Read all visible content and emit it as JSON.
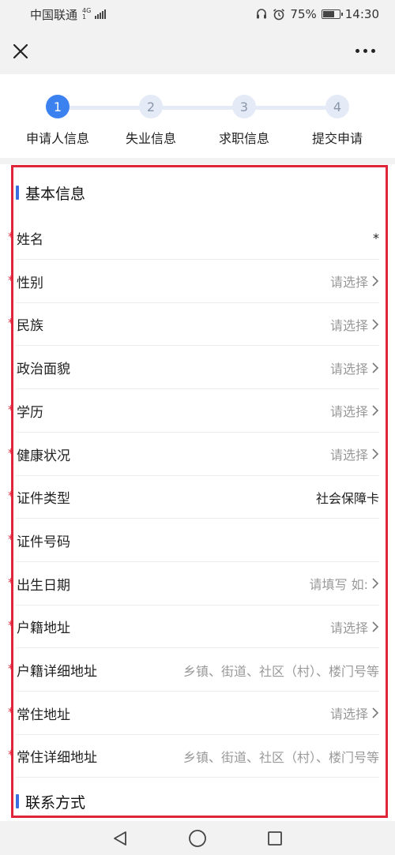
{
  "status": {
    "carrier": "中国联通",
    "net_top": "4G",
    "net_bottom": "1",
    "battery": "75%",
    "battery_level": 0.75,
    "time": "14:30"
  },
  "icons": {
    "close": "close-icon",
    "more": "more-icon",
    "chevron": "chevron-right-icon",
    "back": "back-triangle-icon",
    "home": "home-circle-icon",
    "recent": "recent-square-icon"
  },
  "colors": {
    "accent": "#3b82f0",
    "required": "#e0243a",
    "frame": "#e0243a"
  },
  "steps": [
    {
      "num": "1",
      "label": "申请人信息",
      "active": true
    },
    {
      "num": "2",
      "label": "失业信息",
      "active": false
    },
    {
      "num": "3",
      "label": "求职信息",
      "active": false
    },
    {
      "num": "4",
      "label": "提交申请",
      "active": false
    }
  ],
  "section_basic": {
    "title": "基本信息"
  },
  "section_contact": {
    "title": "联系方式"
  },
  "fields": [
    {
      "label": "姓名",
      "value": "*",
      "required": true,
      "chevron": false,
      "filled": true
    },
    {
      "label": "性别",
      "value": "请选择",
      "required": true,
      "chevron": true,
      "filled": false
    },
    {
      "label": "民族",
      "value": "请选择",
      "required": true,
      "chevron": true,
      "filled": false
    },
    {
      "label": "政治面貌",
      "value": "请选择",
      "required": false,
      "chevron": true,
      "filled": false
    },
    {
      "label": "学历",
      "value": "请选择",
      "required": true,
      "chevron": true,
      "filled": false
    },
    {
      "label": "健康状况",
      "value": "请选择",
      "required": true,
      "chevron": true,
      "filled": false
    },
    {
      "label": "证件类型",
      "value": "社会保障卡",
      "required": true,
      "chevron": false,
      "filled": true
    },
    {
      "label": "证件号码",
      "value": "",
      "required": true,
      "chevron": false,
      "filled": true
    },
    {
      "label": "出生日期",
      "value": "请填写 如:",
      "required": true,
      "chevron": true,
      "filled": false
    },
    {
      "label": "户籍地址",
      "value": "请选择",
      "required": true,
      "chevron": true,
      "filled": false
    },
    {
      "label": "户籍详细地址",
      "value": "乡镇、街道、社区（村）、楼门号等",
      "required": true,
      "chevron": false,
      "filled": false
    },
    {
      "label": "常住地址",
      "value": "请选择",
      "required": true,
      "chevron": true,
      "filled": false
    },
    {
      "label": "常住详细地址",
      "value": "乡镇、街道、社区（村）、楼门号等",
      "required": true,
      "chevron": false,
      "filled": false
    }
  ]
}
